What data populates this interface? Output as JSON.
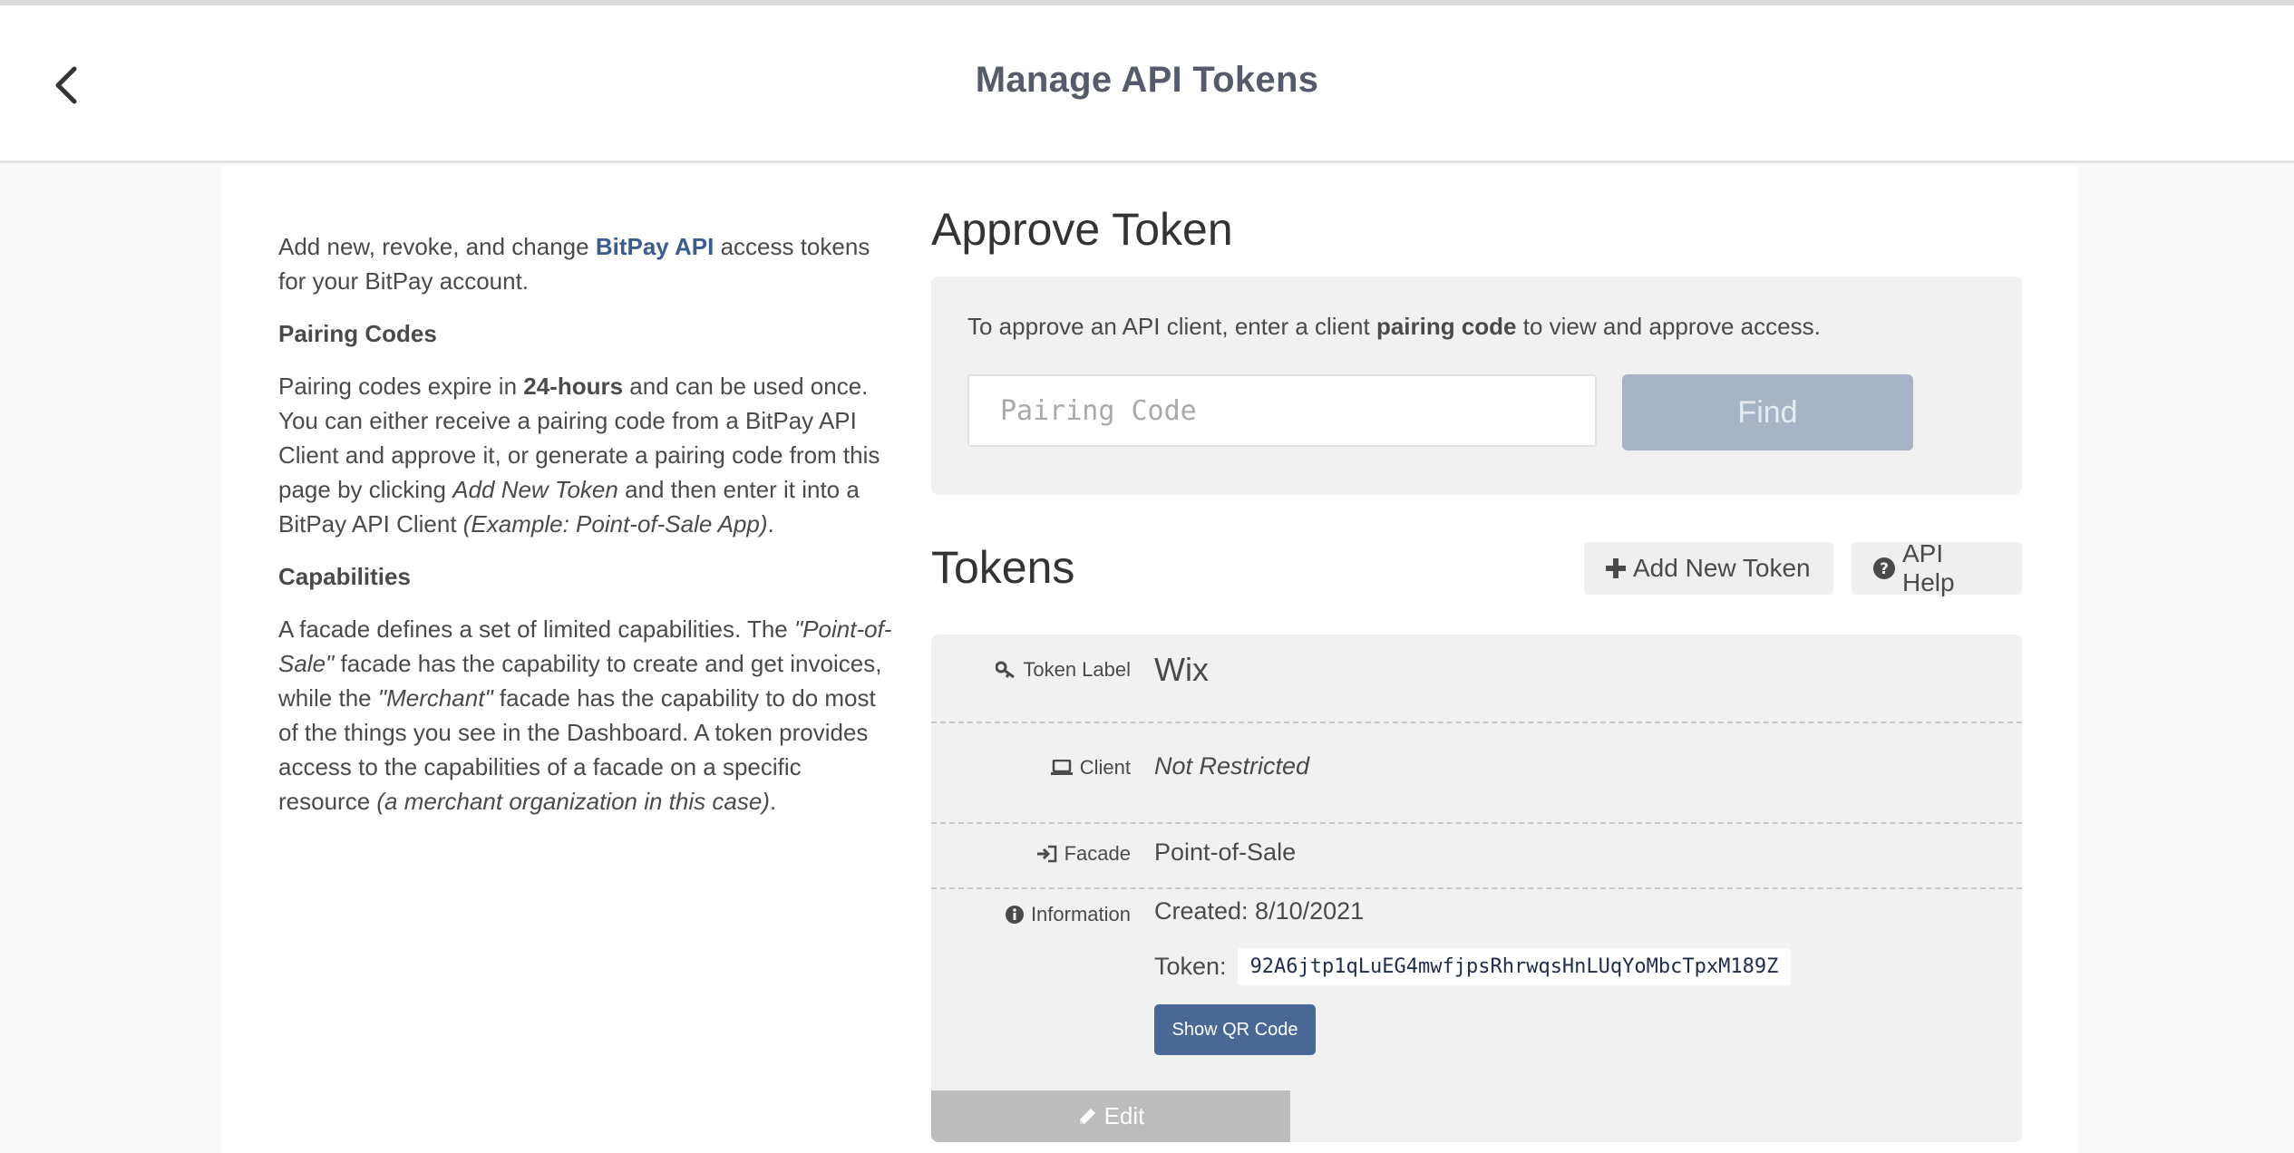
{
  "header": {
    "title": "Manage API Tokens",
    "back_icon": "chevron-left-icon"
  },
  "intro": {
    "text_before": "Add new, revoke, and change ",
    "link": "BitPay API",
    "text_after": " access tokens for your BitPay account."
  },
  "pairing_codes": {
    "heading": "Pairing Codes",
    "p1": "Pairing codes expire in ",
    "bold": "24-hours",
    "p2": " and can be used once. You can either receive a pairing code from a BitPay API Client and approve it, or generate a pairing code from this page by clicking ",
    "italic1": "Add New Token",
    "p3": " and then enter it into a BitPay API Client ",
    "italic2": "(Example: Point-of-Sale App)",
    "p4": "."
  },
  "capabilities": {
    "heading": "Capabilities",
    "p1": "A facade defines a set of limited capabilities.  The ",
    "italic1": "\"Point-of-Sale\"",
    "p2": " facade has the capability to create and get invoices, while the ",
    "italic2": "\"Merchant\"",
    "p3": " facade has the capability to do most of the things you see in the Dashboard.  A token provides access to the capabilities of a facade on a specific resource ",
    "italic3": "(a merchant organization in this case)",
    "p4": "."
  },
  "approve": {
    "title": "Approve Token",
    "text_before": "To approve an API client, enter a client ",
    "bold": "pairing code",
    "text_after": " to view and approve access.",
    "input_placeholder": "Pairing Code",
    "input_value": "",
    "find_label": "Find"
  },
  "tokens": {
    "title": "Tokens",
    "add_label": "Add New Token",
    "help_label": "API Help",
    "card": {
      "label_label": "Token Label",
      "label_value": "Wix",
      "client_label": "Client",
      "client_value": "Not Restricted",
      "facade_label": "Facade",
      "facade_value": "Point-of-Sale",
      "info_label": "Information",
      "created": "Created: 8/10/2021",
      "token_label": "Token:",
      "token_value": "92A6jtp1qLuEG4mwfjpsRhrwqsHnLUqYoMbcTpxM189Z",
      "qr_label": "Show QR Code",
      "edit_label": "Edit"
    }
  },
  "colors": {
    "link": "#3b5c8c",
    "find_button": "#a8b4c6",
    "qr_button": "#4a6896",
    "edit_button": "#bcbcbc"
  }
}
